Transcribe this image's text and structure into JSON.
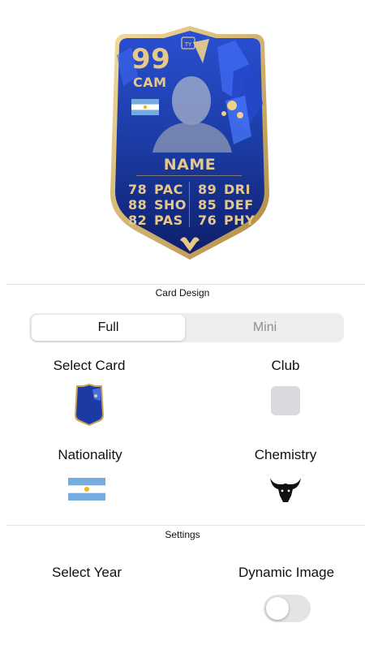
{
  "card": {
    "rating": "99",
    "position": "CAM",
    "name": "NAME",
    "left_stats": [
      {
        "value": "78",
        "label": "PAC"
      },
      {
        "value": "88",
        "label": "SHO"
      },
      {
        "value": "82",
        "label": "PAS"
      }
    ],
    "right_stats": [
      {
        "value": "89",
        "label": "DRI"
      },
      {
        "value": "85",
        "label": "DEF"
      },
      {
        "value": "76",
        "label": "PHY"
      }
    ],
    "colors": {
      "gold": "#e6c98a",
      "blue": "#1a3aa0",
      "dark_blue": "#0e1f6b"
    }
  },
  "card_design": {
    "section_label": "Card Design",
    "tabs": [
      "Full",
      "Mini"
    ],
    "selected_tab": "Full"
  },
  "options": {
    "select_card": "Select Card",
    "club": "Club",
    "nationality": "Nationality",
    "chemistry": "Chemistry"
  },
  "settings": {
    "section_label": "Settings",
    "select_year": "Select Year",
    "dynamic_image": "Dynamic Image",
    "dynamic_image_on": false
  },
  "icons": {
    "flag": "argentina-flag-icon",
    "chemistry": "bull-head-icon"
  }
}
